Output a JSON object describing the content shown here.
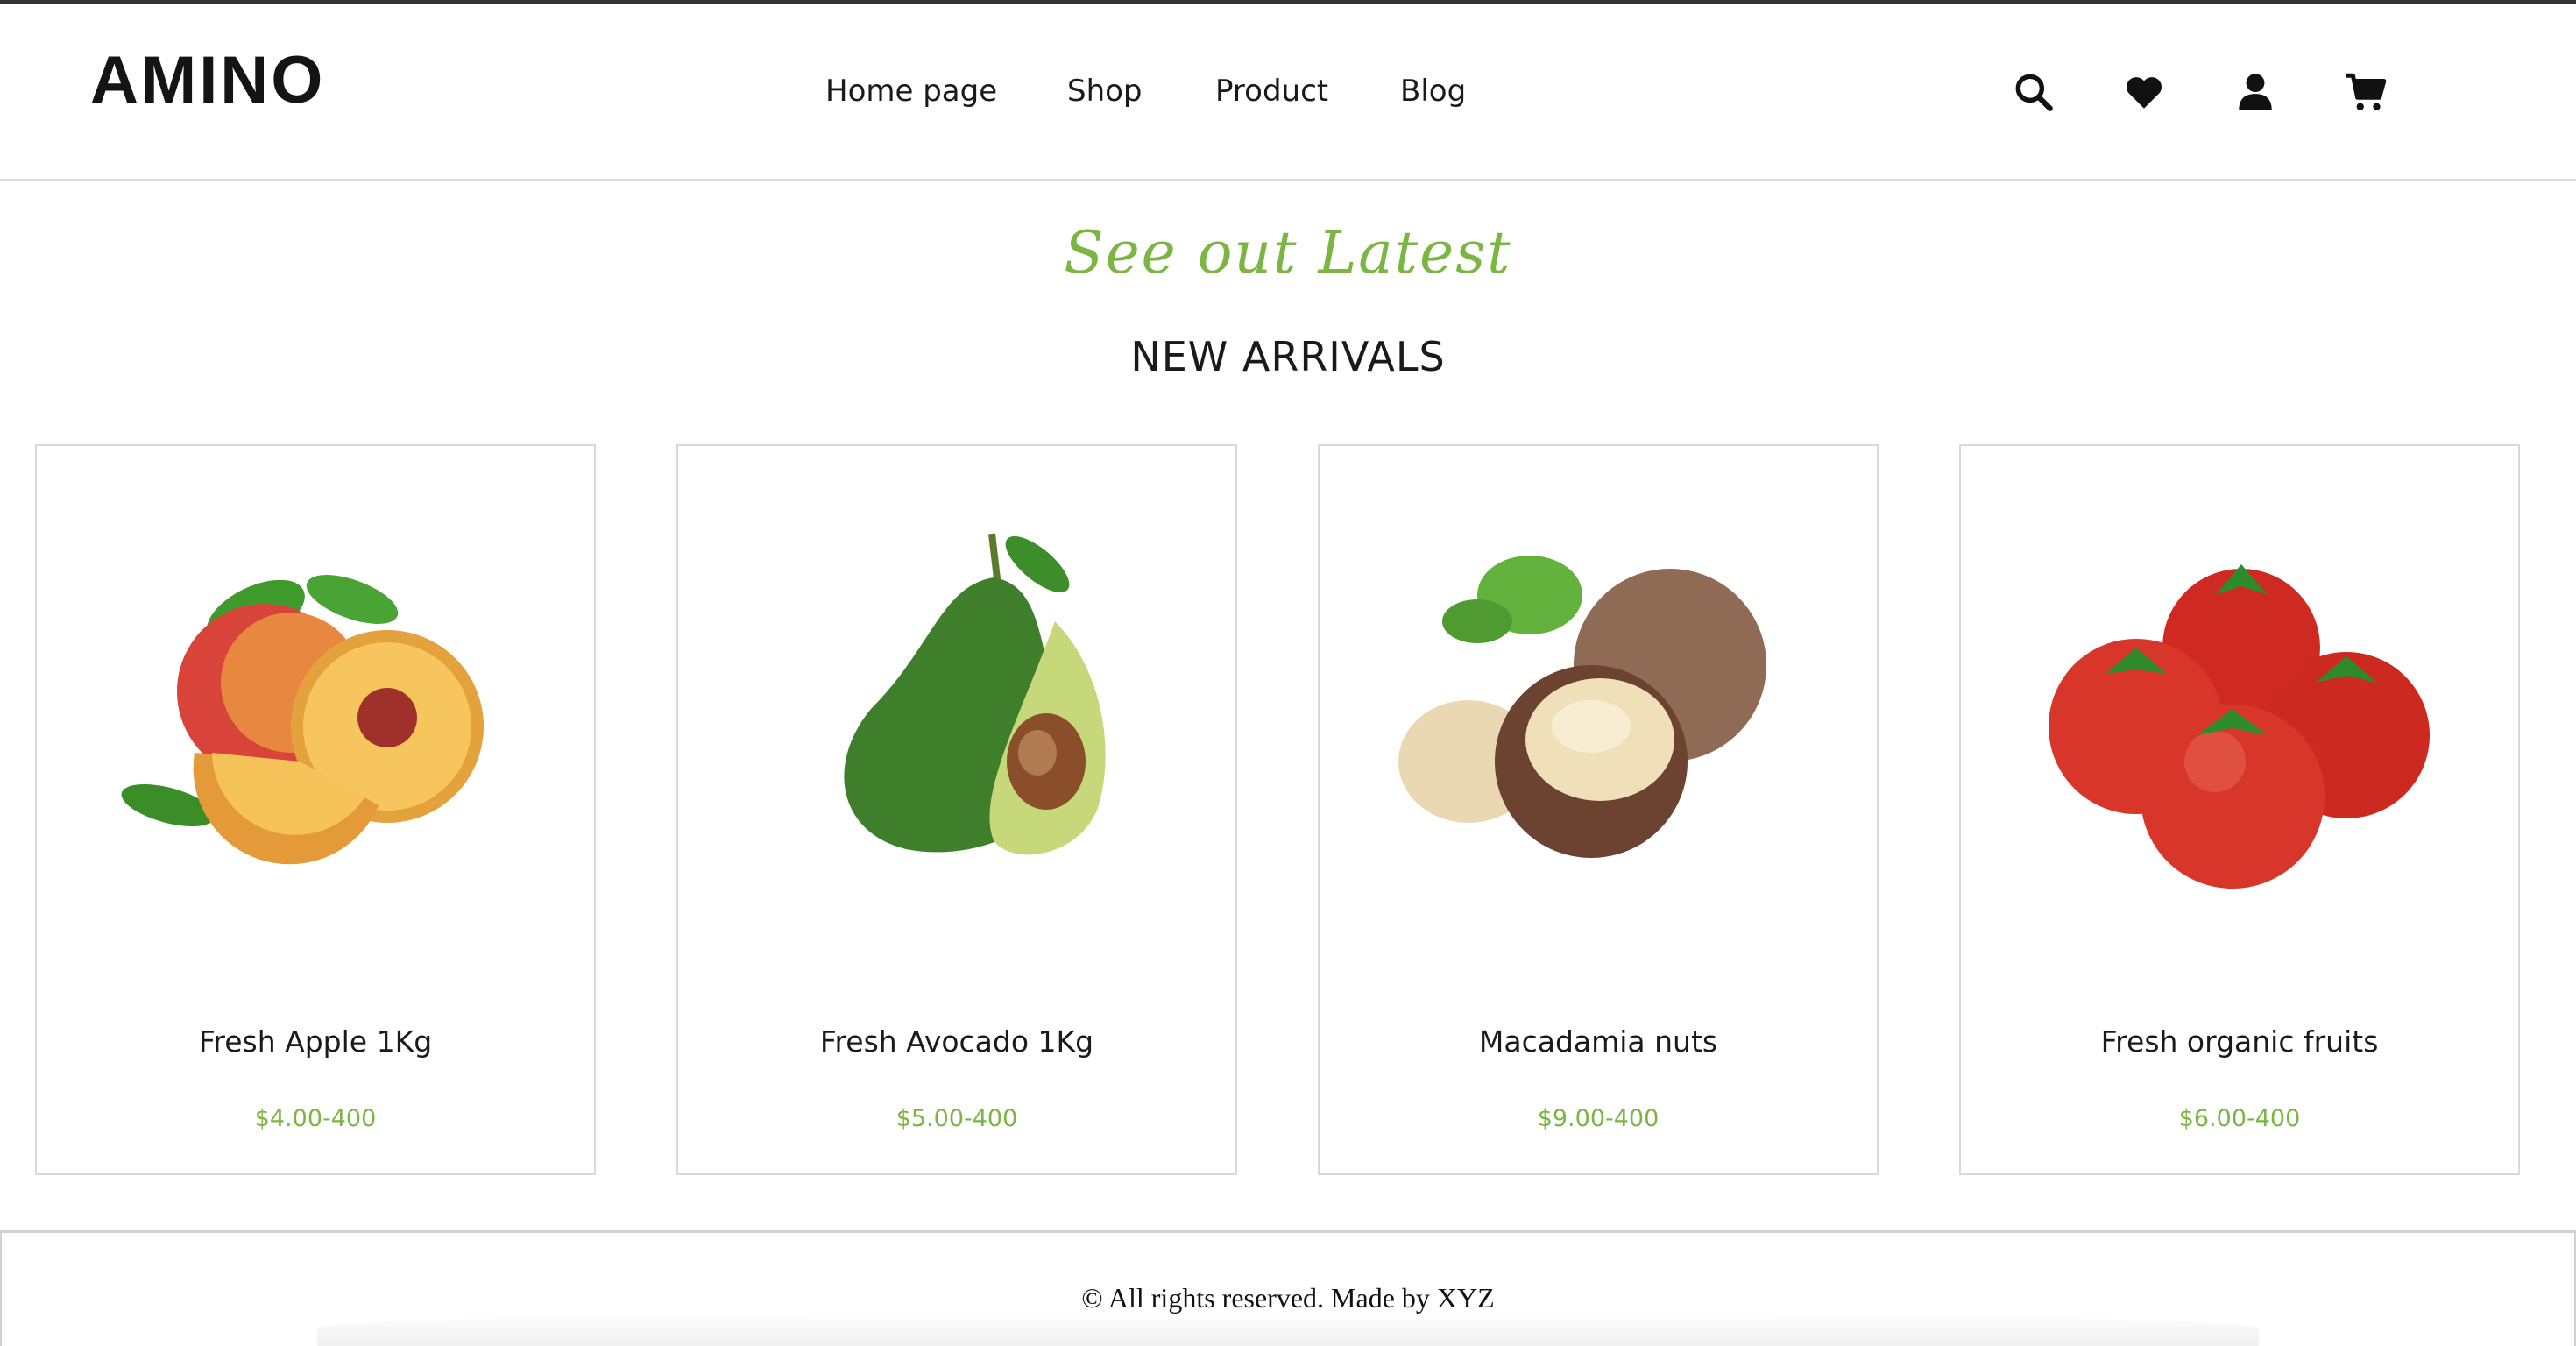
{
  "brand": {
    "logo": "AMINO"
  },
  "nav": {
    "items": [
      {
        "label": "Home page"
      },
      {
        "label": "Shop"
      },
      {
        "label": "Product"
      },
      {
        "label": "Blog"
      }
    ]
  },
  "header_icons": [
    "search-icon",
    "heart-icon",
    "user-icon",
    "cart-icon"
  ],
  "hero": {
    "script_heading": "See out Latest",
    "heading": "NEW ARRIVALS"
  },
  "products": [
    {
      "name": "Fresh Apple 1Kg",
      "price": "$4.00-400",
      "image": "peach-image"
    },
    {
      "name": "Fresh Avocado 1Kg",
      "price": "$5.00-400",
      "image": "avocado-image"
    },
    {
      "name": "Macadamia nuts",
      "price": "$9.00-400",
      "image": "macadamia-image"
    },
    {
      "name": "Fresh organic fruits",
      "price": "$6.00-400",
      "image": "tomatoes-image"
    }
  ],
  "footer": {
    "text": "© All rights reserved. Made by XYZ"
  },
  "colors": {
    "accent": "#7bb544",
    "text": "#1a1a1a",
    "border": "#d9d9d9"
  }
}
